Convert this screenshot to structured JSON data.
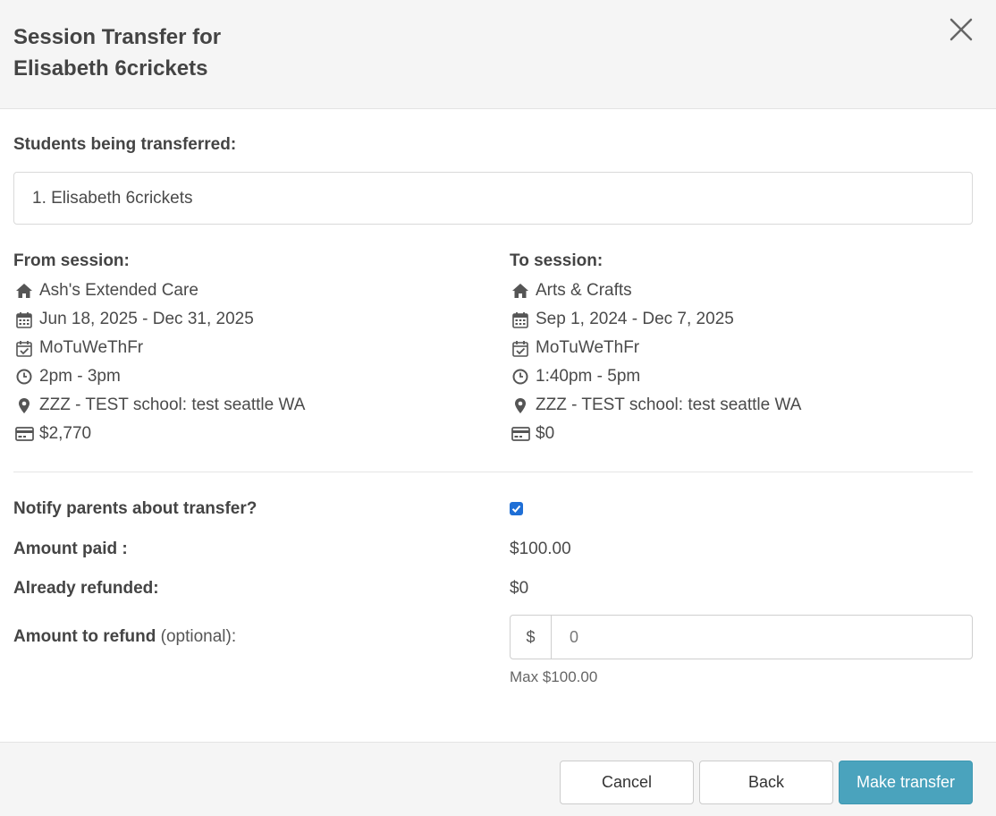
{
  "modal": {
    "title_line1": "Session Transfer for",
    "title_line2": "Elisabeth 6crickets"
  },
  "students": {
    "label": "Students being transferred:",
    "items": [
      "1. Elisabeth 6crickets"
    ]
  },
  "from_session": {
    "label": "From session:",
    "name": "Ash's Extended Care",
    "dates": "Jun 18, 2025 - Dec 31, 2025",
    "days": "MoTuWeThFr",
    "time": "2pm - 3pm",
    "location": "ZZZ - TEST school: test seattle WA",
    "price": "$2,770"
  },
  "to_session": {
    "label": "To session:",
    "name": "Arts & Crafts",
    "dates": "Sep 1, 2024 - Dec 7, 2025",
    "days": "MoTuWeThFr",
    "time": "1:40pm - 5pm",
    "location": "ZZZ - TEST school: test seattle WA",
    "price": "$0"
  },
  "icons": {
    "name": "home-icon",
    "dates": "calendar-icon",
    "days": "calendar-check-icon",
    "time": "clock-icon",
    "location": "map-marker-icon",
    "price": "credit-card-icon"
  },
  "form": {
    "notify_label": "Notify parents about transfer?",
    "notify_checked": true,
    "amount_paid_label": "Amount paid :",
    "amount_paid_value": "$100.00",
    "already_refunded_label": "Already refunded:",
    "already_refunded_value": "$0",
    "refund_label": "Amount to refund",
    "refund_optional": "(optional):",
    "currency_symbol": "$",
    "refund_placeholder": "0",
    "refund_help": "Max $100.00"
  },
  "footer": {
    "cancel_label": "Cancel",
    "back_label": "Back",
    "transfer_label": "Make transfer"
  },
  "colors": {
    "primary": "#4aa3bd",
    "checkbox": "#1f6fd6",
    "icon": "#555555"
  }
}
